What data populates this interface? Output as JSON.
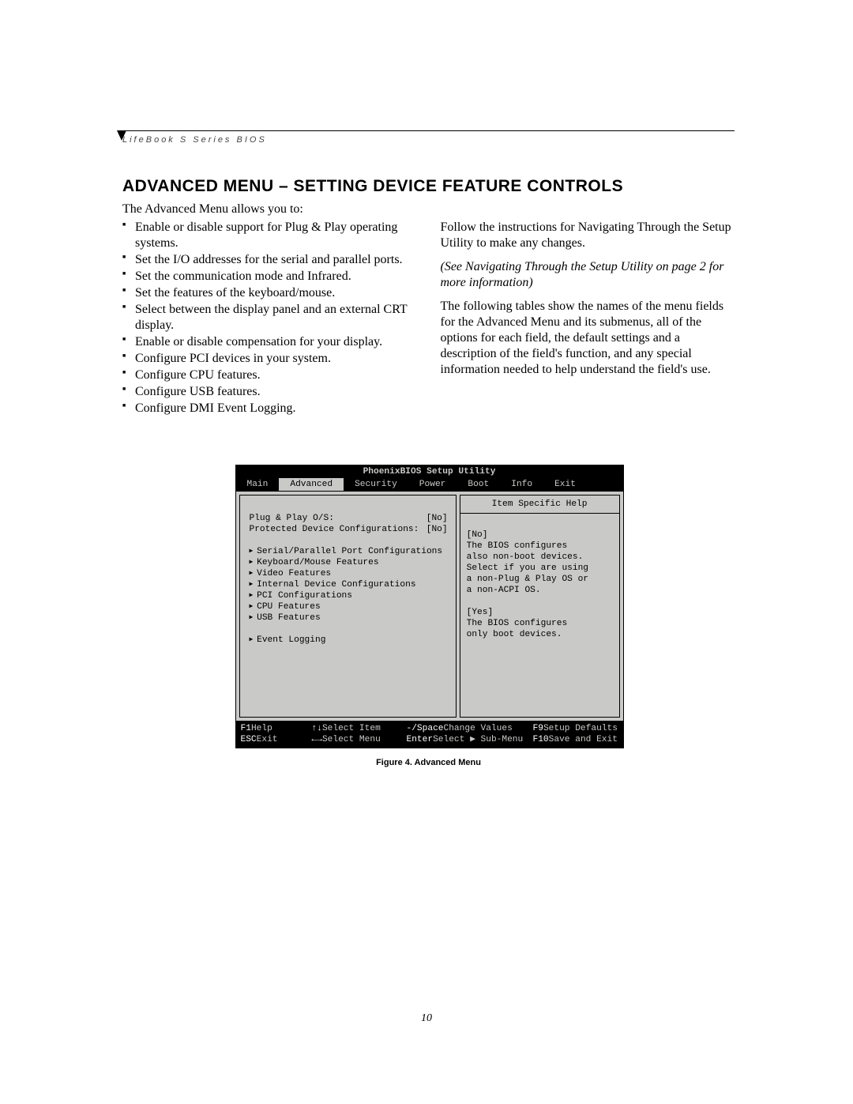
{
  "header": {
    "label": "LifeBook S Series BIOS"
  },
  "title": "ADVANCED MENU – SETTING DEVICE FEATURE CONTROLS",
  "intro": "The Advanced Menu allows you to:",
  "bullets": [
    "Enable or disable support for Plug & Play operating systems.",
    "Set the I/O addresses for the serial and parallel ports.",
    "Set the communication mode and Infrared.",
    "Set the features of the keyboard/mouse.",
    "Select between the display panel and an external CRT display.",
    "Enable or disable compensation for your display.",
    "Configure PCI devices in your system.",
    "Configure CPU features.",
    "Configure USB features.",
    "Configure DMI Event Logging."
  ],
  "right_col": {
    "p1": "Follow the instructions for Navigating Through the Setup Utility to make any changes.",
    "p2_italic": "(See Navigating Through the Setup Utility on page 2 for more information)",
    "p3": "The following tables show the names of the menu fields for the Advanced Menu and its submenus, all of the options for each field, the default settings and a description of the field's function, and any special information needed to help understand the field's use."
  },
  "bios": {
    "window_title": "PhoenixBIOS Setup Utility",
    "tabs": [
      "Main",
      "Advanced",
      "Security",
      "Power",
      "Boot",
      "Info",
      "Exit"
    ],
    "active_tab": "Advanced",
    "fields": [
      {
        "label": "Plug & Play O/S:",
        "value": "[No]"
      },
      {
        "label": "Protected Device Configurations:",
        "value": "[No]"
      }
    ],
    "submenus": [
      "Serial/Parallel Port Configurations",
      "Keyboard/Mouse Features",
      "Video Features",
      "Internal Device Configurations",
      "PCI Configurations",
      "CPU Features",
      "USB Features"
    ],
    "extra_submenu": "Event Logging",
    "help": {
      "title": "Item Specific Help",
      "lines": [
        "[No]",
        "The BIOS configures",
        "also non-boot devices.",
        "Select if you are using",
        "a non-Plug & Play OS or",
        "a non-ACPI OS.",
        "",
        "[Yes]",
        "The BIOS configures",
        "only boot devices."
      ]
    },
    "footer": {
      "row1": [
        {
          "k": "F1",
          "v": " Help"
        },
        {
          "k": "↑↓",
          "v": " Select Item"
        },
        {
          "k": "-/Space",
          "v": " Change Values"
        },
        {
          "k": "F9",
          "v": "  Setup Defaults"
        }
      ],
      "row2": [
        {
          "k": "ESC",
          "v": " Exit"
        },
        {
          "k": "←→",
          "v": " Select Menu"
        },
        {
          "k": "Enter",
          "v": " Select ▶ Sub-Menu"
        },
        {
          "k": "F10",
          "v": " Save and Exit"
        }
      ]
    }
  },
  "figure_caption": "Figure 4.   Advanced Menu",
  "page_number": "10"
}
